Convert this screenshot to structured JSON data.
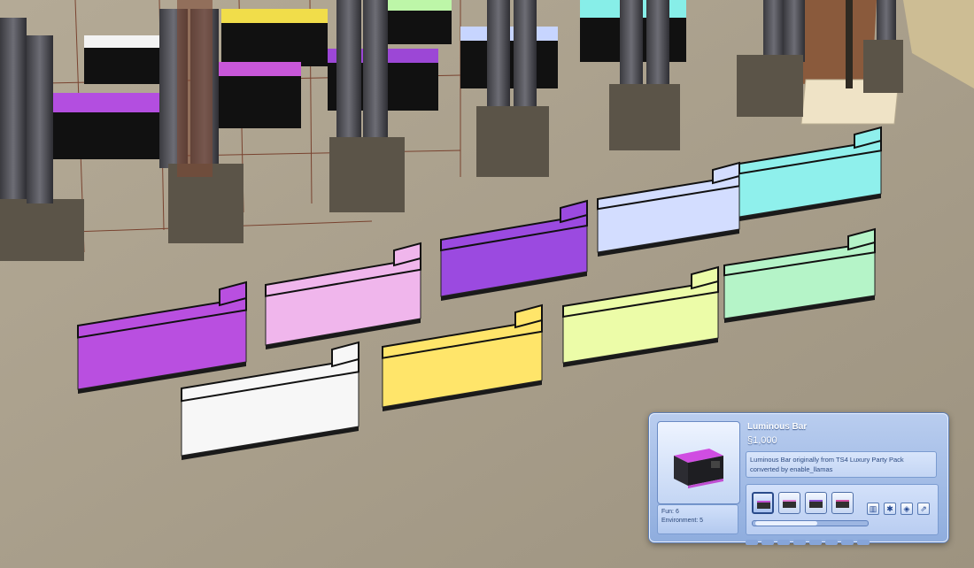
{
  "catalog": {
    "item_name": "Luminous Bar",
    "price": "§1,000",
    "description_line1": "Luminous Bar originally from TS4 Luxury Party Pack",
    "description_line2": "converted by enable_llamas",
    "stats": {
      "fun": "Fun: 6",
      "environment": "Environment: 5"
    },
    "swatches": [
      "magenta",
      "pink",
      "purple",
      "black"
    ],
    "selected_swatch": "magenta",
    "tools": [
      {
        "icon": "trash-icon"
      },
      {
        "icon": "sparkle-icon"
      },
      {
        "icon": "design-tool-icon"
      },
      {
        "icon": "expand-icon"
      }
    ]
  },
  "scene": {
    "bar_colors": [
      "#b94fe0",
      "#f0b6ec",
      "#9b4ae0",
      "#d3ddff",
      "#8ff0ec",
      "#f7f7f7",
      "#ffe56a",
      "#ecfca8",
      "#b5f4c8"
    ]
  }
}
